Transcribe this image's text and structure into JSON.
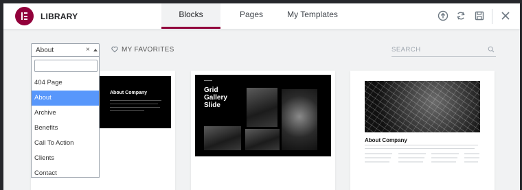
{
  "header": {
    "title": "LIBRARY",
    "tabs": [
      {
        "label": "Blocks",
        "active": true
      },
      {
        "label": "Pages",
        "active": false
      },
      {
        "label": "My Templates",
        "active": false
      }
    ],
    "icons": [
      "upload-icon",
      "sync-icon",
      "save-icon",
      "close-icon"
    ]
  },
  "filter": {
    "selected": "About",
    "clear_glyph": "×",
    "options": [
      "404 Page",
      "About",
      "Archive",
      "Benefits",
      "Call To Action",
      "Clients",
      "Contact"
    ],
    "search_value": ""
  },
  "favorites": {
    "label": "MY FAVORITES"
  },
  "search": {
    "placeholder": "SEARCH"
  },
  "cards": [
    {
      "thumb_title": "About Company"
    },
    {
      "thumb_title_lines": [
        "Grid",
        "Gallery",
        "Slide"
      ]
    },
    {
      "thumb_title": "About Company"
    }
  ],
  "colors": {
    "brand": "#92003b",
    "option_highlight": "#5897fb",
    "backdrop": "#27282c"
  }
}
